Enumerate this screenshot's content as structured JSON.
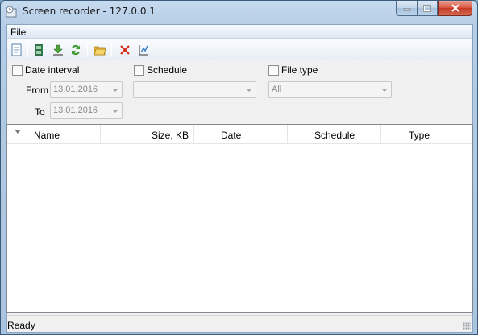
{
  "window": {
    "title": "Screen recorder - 127.0.0.1"
  },
  "menu": {
    "file": "File"
  },
  "toolbar": {
    "icons": [
      "properties-icon",
      "film-icon",
      "download-icon",
      "refresh-icon",
      "open-folder-icon",
      "delete-icon",
      "sync-icon"
    ]
  },
  "filters": {
    "date_interval": {
      "label": "Date interval",
      "checked": false
    },
    "from": {
      "label": "From",
      "value": "13.01.2016"
    },
    "to": {
      "label": "To",
      "value": "13.01.2016"
    },
    "schedule": {
      "label": "Schedule",
      "checked": false,
      "value": ""
    },
    "file_type": {
      "label": "File type",
      "checked": false,
      "value": "All"
    }
  },
  "list": {
    "columns": [
      "Name",
      "Size, KB",
      "Date",
      "Schedule",
      "Type"
    ],
    "rows": []
  },
  "status": {
    "text": "Ready"
  },
  "colors": {
    "close": "#c33923",
    "frame": "#b5cde6",
    "client": "#f0f0f0"
  }
}
